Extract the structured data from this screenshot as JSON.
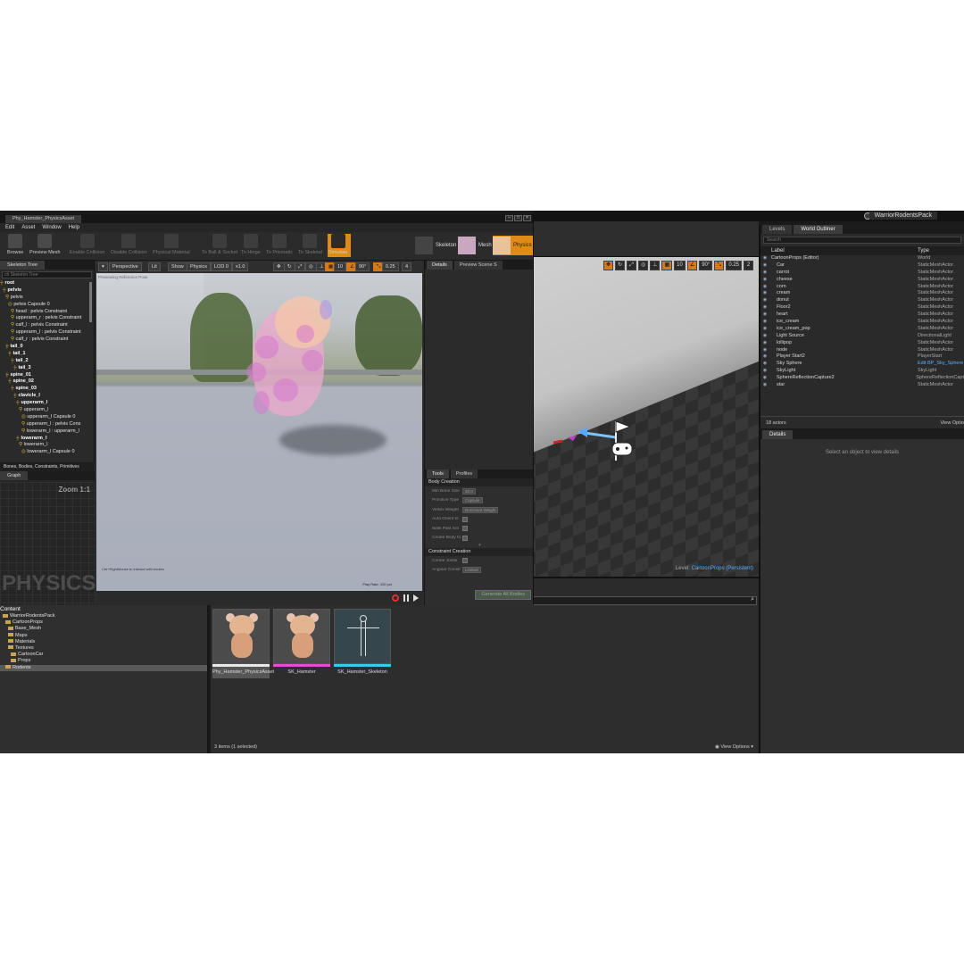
{
  "main_editor": {
    "project_tab": "WarriorRodentsPack",
    "viewport_toolbar": [
      "10",
      "90°",
      "0.25",
      "2"
    ],
    "level_prefix": "Level:",
    "level_name": "CartoonProps (Persistent)"
  },
  "outliner": {
    "tabs": [
      "Levels",
      "World Outliner"
    ],
    "search_placeholder": "Search",
    "col_label": "Label",
    "col_type": "Type",
    "rows": [
      {
        "name": "CartoonProps (Editor)",
        "type": "World"
      },
      {
        "name": "Car",
        "type": "StaticMeshActor"
      },
      {
        "name": "carrot",
        "type": "StaticMeshActor"
      },
      {
        "name": "cheese",
        "type": "StaticMeshActor"
      },
      {
        "name": "corn",
        "type": "StaticMeshActor"
      },
      {
        "name": "cream",
        "type": "StaticMeshActor"
      },
      {
        "name": "donut",
        "type": "StaticMeshActor"
      },
      {
        "name": "Floor2",
        "type": "StaticMeshActor"
      },
      {
        "name": "heart",
        "type": "StaticMeshActor"
      },
      {
        "name": "ice_cream",
        "type": "StaticMeshActor"
      },
      {
        "name": "ice_cream_pop",
        "type": "StaticMeshActor"
      },
      {
        "name": "Light Source",
        "type": "DirectionalLight"
      },
      {
        "name": "lollipop",
        "type": "StaticMeshActor"
      },
      {
        "name": "node",
        "type": "StaticMeshActor"
      },
      {
        "name": "Player Start2",
        "type": "PlayerStart"
      },
      {
        "name": "Sky Sphere",
        "type": "Edit BP_Sky_Sphere"
      },
      {
        "name": "SkyLight",
        "type": "SkyLight"
      },
      {
        "name": "SphereReflectionCapture2",
        "type": "SphereReflectionCapt"
      },
      {
        "name": "star",
        "type": "StaticMeshActor"
      }
    ],
    "count": "18 actors",
    "view_options": "View Optio"
  },
  "details": {
    "tab": "Details",
    "empty_text": "Select an object to view details"
  },
  "physics_editor": {
    "doc_tab": "Phy_Hamster_PhysicsAsset",
    "menu": [
      "Edit",
      "Asset",
      "Window",
      "Help"
    ],
    "toolbar": [
      "Browse",
      "Preview Mesh",
      "Enable Collision",
      "Disable Collision",
      "Physical Material",
      "To Ball & Socket",
      "To Hinge",
      "To Prismatic",
      "To Skeletal",
      "Simulate"
    ],
    "modes": [
      "Skeleton",
      "Mesh",
      "Physics"
    ],
    "skeleton_tree": {
      "tab": "Skeleton Tree",
      "search_placeholder": "ch Skeleton Tree",
      "rows": [
        {
          "text": "root",
          "style": "b"
        },
        {
          "text": "pelvis",
          "style": "b"
        },
        {
          "text": "pelvis",
          "style": "n"
        },
        {
          "text": "pelvis Capsule 0",
          "style": "s"
        },
        {
          "text": "head : pelvis Constraint",
          "style": "n"
        },
        {
          "text": "upperarm_r : pelvis Constraint",
          "style": "n"
        },
        {
          "text": "calf_l : pelvis Constraint",
          "style": "n"
        },
        {
          "text": "upperarm_l : pelvis Constraint",
          "style": "n"
        },
        {
          "text": "calf_r : pelvis Constraint",
          "style": "n"
        },
        {
          "text": "tail_0",
          "style": "b"
        },
        {
          "text": "tail_1",
          "style": "b"
        },
        {
          "text": "tail_2",
          "style": "b"
        },
        {
          "text": "tail_3",
          "style": "b"
        },
        {
          "text": "spine_01",
          "style": "b"
        },
        {
          "text": "spine_02",
          "style": "b"
        },
        {
          "text": "spine_03",
          "style": "b"
        },
        {
          "text": "clavicle_l",
          "style": "b"
        },
        {
          "text": "upperarm_l",
          "style": "b"
        },
        {
          "text": "upperarm_l",
          "style": "n"
        },
        {
          "text": "upperarm_l Capsule 0",
          "style": "s"
        },
        {
          "text": "upperarm_l : pelvis Cons",
          "style": "n"
        },
        {
          "text": "lowerarm_l : upperarm_l",
          "style": "n"
        },
        {
          "text": "lowerarm_l",
          "style": "b"
        },
        {
          "text": "lowerarm_l",
          "style": "n"
        },
        {
          "text": "lowerarm_l Capsule 0",
          "style": "s"
        }
      ],
      "filter": "Bones, Bodies, Constraints, Primitives"
    },
    "graph": {
      "tab": "Graph",
      "zoom": "Zoom 1:1",
      "watermark": "PHYSICS"
    },
    "viewport": {
      "chips": [
        "Perspective",
        "Lit",
        "Show",
        "Physics",
        "LOD 0",
        "x1.0"
      ],
      "right_chips": [
        "10",
        "90°",
        "0.25",
        "4"
      ],
      "overlay_hint": "Previewing Reference Pose",
      "hint": "Ctrl+RightMouse to interact with bodies",
      "play_rate": "Play Rate: 100 pct"
    },
    "details_tabs": [
      "Details",
      "Preview Scene S"
    ],
    "tools": {
      "tabs": [
        "Tools",
        "Profiles"
      ],
      "body_section": "Body Creation",
      "body_props": [
        {
          "label": "Min Bone Size",
          "value": "20.0"
        },
        {
          "label": "Primitive Type",
          "value": "Capsule"
        },
        {
          "label": "Vertex Weight",
          "value": "Dominant Weight"
        },
        {
          "label": "Auto Orient to",
          "value": ""
        },
        {
          "label": "Walk Past Sm",
          "value": ""
        },
        {
          "label": "Create Body fo",
          "value": ""
        }
      ],
      "constraint_section": "Constraint Creation",
      "constraint_props": [
        {
          "label": "Create Joints",
          "value": ""
        },
        {
          "label": "Angular Constr",
          "value": "Limited"
        }
      ],
      "generate_button": "Generate All Bodies"
    }
  },
  "content_browser": {
    "tree": [
      {
        "text": "Content",
        "level": 0,
        "head": true
      },
      {
        "text": "WarriorRodentsPack",
        "level": 1
      },
      {
        "text": "CartoonProps",
        "level": 2
      },
      {
        "text": "Base_Mesh",
        "level": 3
      },
      {
        "text": "Maps",
        "level": 3
      },
      {
        "text": "Materials",
        "level": 3
      },
      {
        "text": "Textures",
        "level": 3
      },
      {
        "text": "CartoonCar",
        "level": 4
      },
      {
        "text": "Props",
        "level": 4
      },
      {
        "text": "Rodents",
        "level": 2,
        "sel": true
      }
    ],
    "assets": [
      {
        "label": "Phy_Hamster_PhysicsAsset",
        "bar_color": "#e8e8e8",
        "type": "hamster"
      },
      {
        "label": "SK_Hamster",
        "bar_color": "#e14ed0",
        "type": "hamster"
      },
      {
        "label": "SK_Hamster_Skeleton",
        "bar_color": "#3cc8e8",
        "type": "skeleton"
      }
    ],
    "status": "3 items (1 selected)",
    "view_options": "View Options"
  }
}
